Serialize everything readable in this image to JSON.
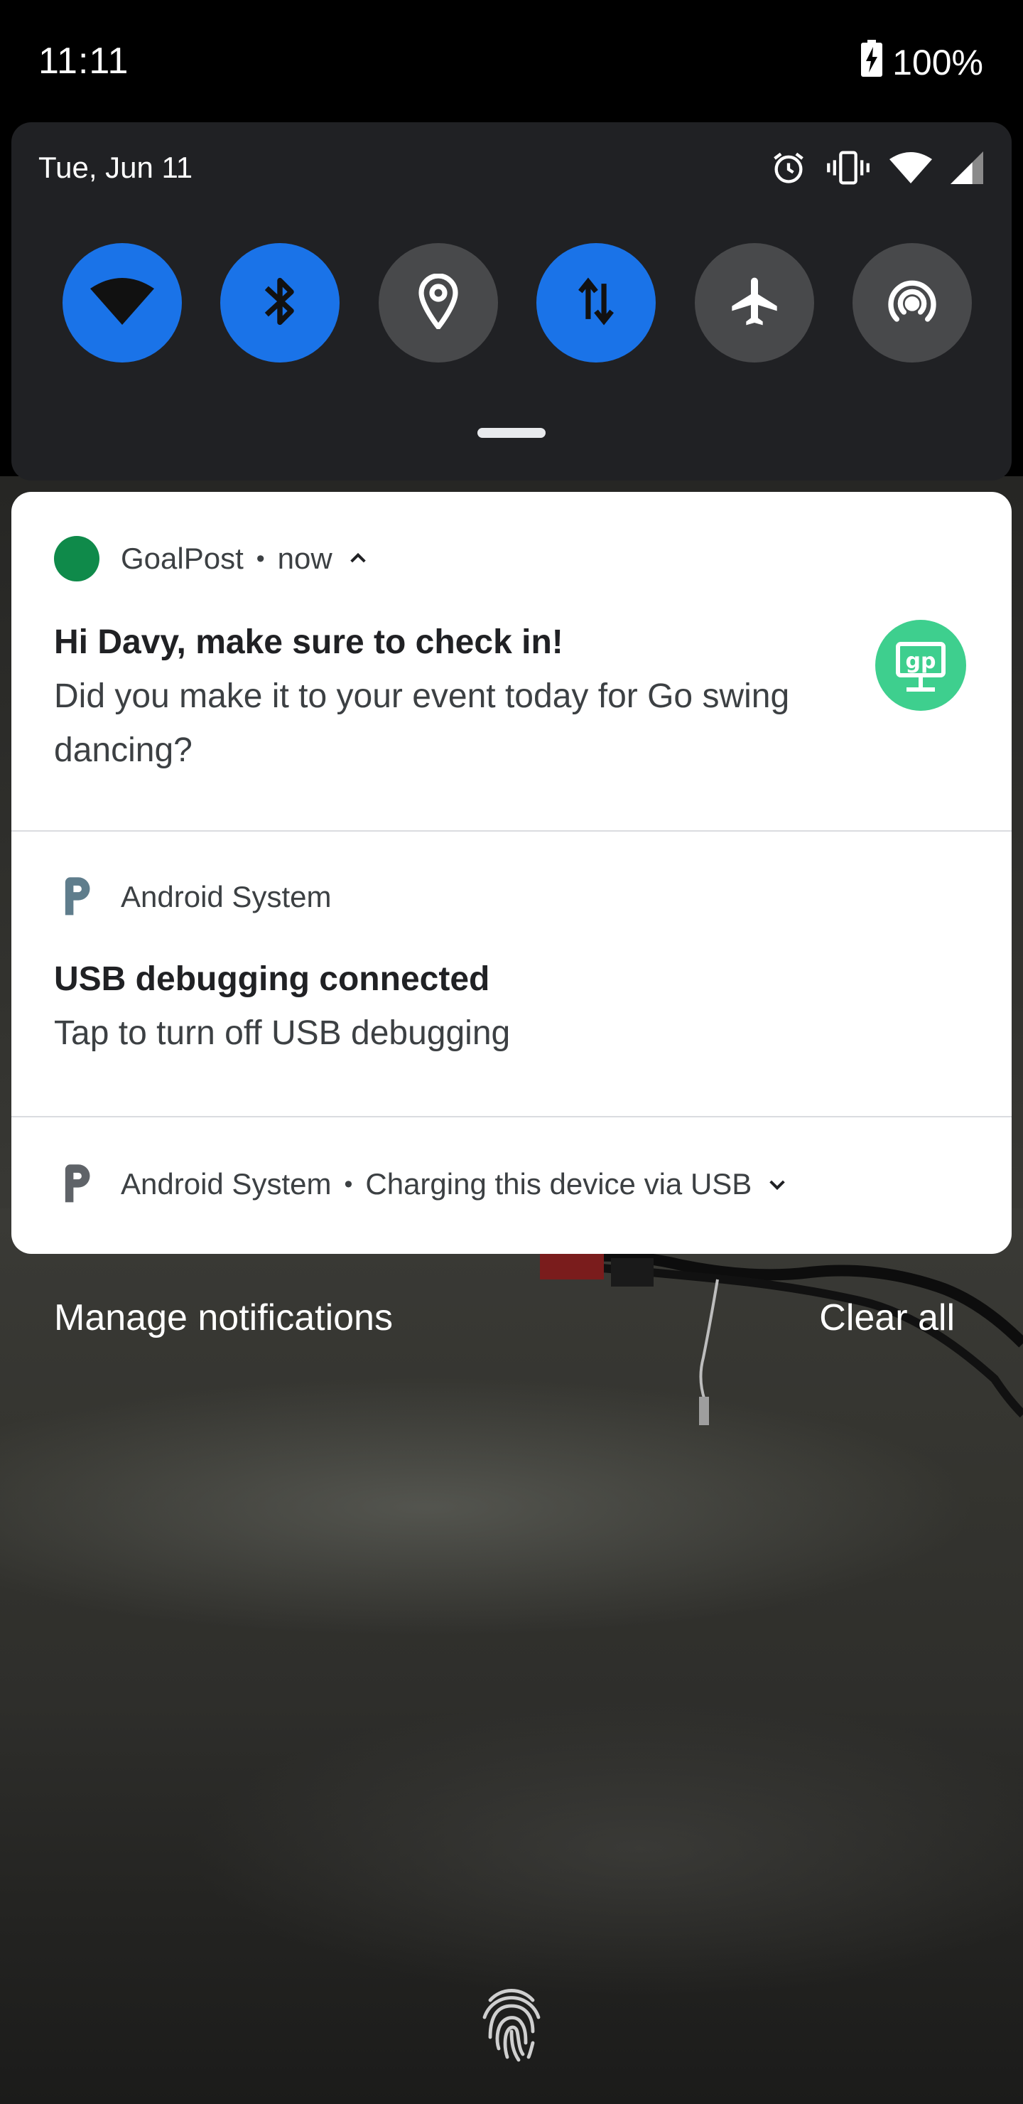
{
  "status_bar": {
    "time": "11:11",
    "battery_percent": "100%",
    "battery_icon": "battery-charging-icon"
  },
  "quick_settings": {
    "date": "Tue, Jun 11",
    "system_icons": [
      "alarm-icon",
      "vibrate-icon",
      "wifi-signal-icon",
      "cell-signal-icon"
    ],
    "tiles": [
      {
        "name": "wifi",
        "icon": "wifi-icon",
        "state": "on"
      },
      {
        "name": "bluetooth",
        "icon": "bluetooth-icon",
        "state": "on"
      },
      {
        "name": "location",
        "icon": "location-icon",
        "state": "off"
      },
      {
        "name": "mobile-data",
        "icon": "data-transfer-icon",
        "state": "on"
      },
      {
        "name": "airplane-mode",
        "icon": "airplane-icon",
        "state": "off"
      },
      {
        "name": "hotspot",
        "icon": "hotspot-icon",
        "state": "off"
      }
    ],
    "colors": {
      "tile_on": "#1a73e8",
      "tile_off": "#48494b",
      "panel": "#202124"
    }
  },
  "notifications": [
    {
      "app": "GoalPost",
      "separator": "•",
      "time": "now",
      "expanded": true,
      "title": "Hi Davy, make sure to check in!",
      "body": "Did you make it to your event today for Go swing dancing?",
      "large_icon_text": "gp",
      "app_color": "#0f8a4a",
      "large_icon_color": "#3ecf8e"
    },
    {
      "app": "Android System",
      "title": "USB debugging connected",
      "body": "Tap to turn off USB debugging"
    },
    {
      "app": "Android System",
      "separator": "•",
      "summary": "Charging this device via USB",
      "expanded": false
    }
  ],
  "footer": {
    "manage_label": "Manage notifications",
    "clear_label": "Clear all"
  }
}
